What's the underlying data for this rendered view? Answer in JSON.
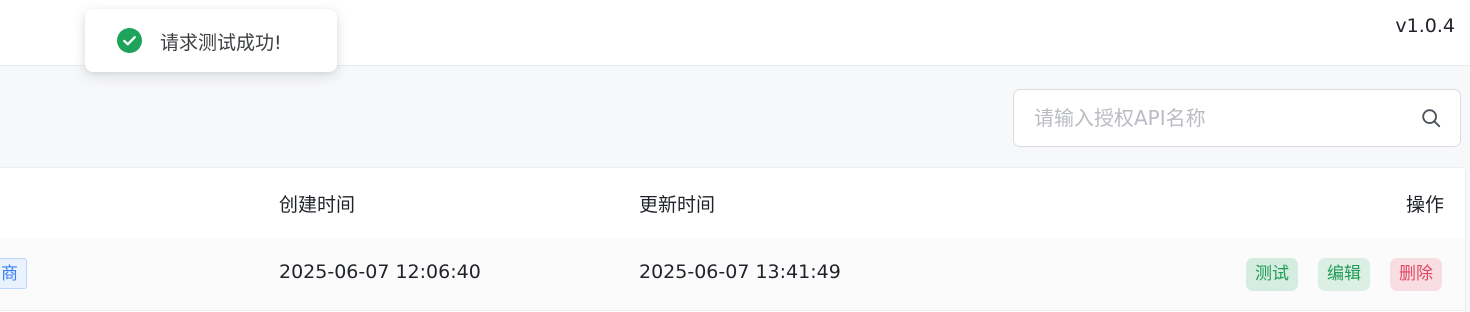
{
  "header": {
    "version": "v1.0.4"
  },
  "toast": {
    "icon": "check-circle-icon",
    "message": "请求测试成功!",
    "color": "#1ea45a"
  },
  "search": {
    "placeholder": "请输入授权API名称",
    "value": "",
    "icon": "search-icon"
  },
  "table": {
    "columns": {
      "created_at": "创建时间",
      "updated_at": "更新时间",
      "actions": "操作"
    },
    "rows": [
      {
        "type_tag": "商",
        "created_at": "2025-06-07 12:06:40",
        "updated_at": "2025-06-07 13:41:49",
        "actions": {
          "test": "测试",
          "edit": "编辑",
          "delete": "删除"
        }
      }
    ]
  },
  "colors": {
    "success": "#1f9d55",
    "danger": "#e04862",
    "info": "#3b82f6"
  }
}
